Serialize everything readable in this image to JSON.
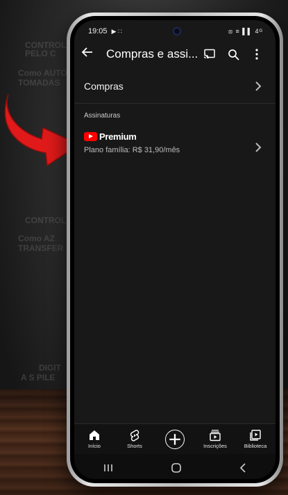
{
  "background_text": [
    "CONTROLE",
    "PELO C",
    "Como AUTO",
    "TOMADAS",
    "CONTROLE",
    "Como AZ",
    "TRANSFER",
    "DIGIT",
    "A S PILE"
  ],
  "status_bar": {
    "time": "19:05",
    "left_icons": "▶ ∷",
    "right_icons": "⦻ ≡ ▌▌ 4ᴳ"
  },
  "app_bar": {
    "title": "Compras e assi...",
    "back_icon": "back-arrow-icon",
    "cast_icon": "cast-icon",
    "search_icon": "search-icon",
    "more_icon": "more-vert-icon"
  },
  "rows": {
    "purchases_label": "Compras"
  },
  "section": {
    "subscriptions_header": "Assinaturas"
  },
  "premium": {
    "brand_label": "Premium",
    "plan_text": "Plano família: R$ 31,90/mês"
  },
  "bottom_nav": {
    "home": "Início",
    "shorts": "Shorts",
    "subscriptions": "Inscrições",
    "library": "Biblioteca"
  },
  "colors": {
    "screen_bg": "#181818",
    "accent_red": "#ff0000",
    "text": "#ffffff"
  }
}
